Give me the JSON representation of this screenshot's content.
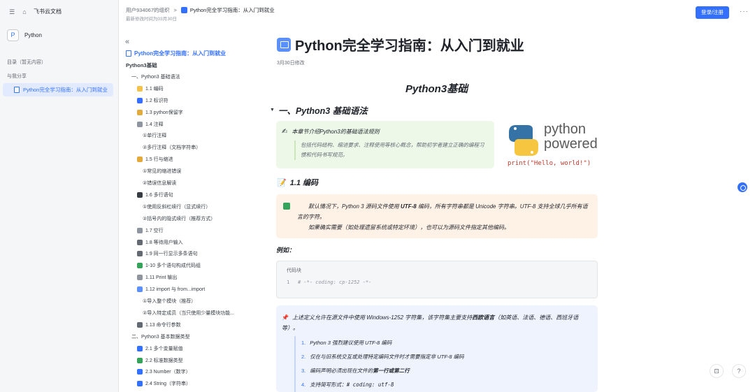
{
  "sidebar": {
    "app_name": "飞书云文档",
    "space_name": "Python",
    "space_logo": "P",
    "toc_label": "目录（暂无内容）",
    "shared_label": "与我分享",
    "shared_doc": "Python完全学习指南：从入门到就业"
  },
  "header": {
    "breadcrumb_org": "用户934067的组织",
    "breadcrumb_sep": ">",
    "breadcrumb_doc": "Python完全学习指南：从入门到就业",
    "last_modified": "最新修改时间为03月30日",
    "login_label": "登录/注册",
    "more_label": "···"
  },
  "outline": {
    "collapse_label": "«",
    "top": "Python完全学习指南：从入门到就业",
    "items": [
      {
        "label": "Python3基础",
        "level": 0,
        "icon": ""
      },
      {
        "label": "一、Python3 基础语法",
        "level": 1,
        "icon": ""
      },
      {
        "label": "1.1 编码",
        "level": 2,
        "icon": "#f5c04b"
      },
      {
        "label": "1.2 标识符",
        "level": 2,
        "icon": "#3370ff"
      },
      {
        "label": "1.3 python保留字",
        "level": 2,
        "icon": "#e2a93b"
      },
      {
        "label": "1.4 注释",
        "level": 2,
        "icon": "#8f959e"
      },
      {
        "label": "①单行注释",
        "level": 3,
        "icon": ""
      },
      {
        "label": "②多行注释（文档字符串）",
        "level": 3,
        "icon": ""
      },
      {
        "label": "1.5 行与缩进",
        "level": 2,
        "icon": "#e2a93b"
      },
      {
        "label": "①常见的缩进错误",
        "level": 3,
        "icon": ""
      },
      {
        "label": "②错误信息解读",
        "level": 3,
        "icon": ""
      },
      {
        "label": "1.6 多行语句",
        "level": 2,
        "icon": "#373c43"
      },
      {
        "label": "①使用反斜杠续行（显式续行）",
        "level": 3,
        "icon": ""
      },
      {
        "label": "②括号内的隐式续行（推荐方式）",
        "level": 3,
        "icon": ""
      },
      {
        "label": "1.7 空行",
        "level": 2,
        "icon": "#8f959e"
      },
      {
        "label": "1.8 等待用户输入",
        "level": 2,
        "icon": "#646a73"
      },
      {
        "label": "1.9 同一行显示多条语句",
        "level": 2,
        "icon": "#646a73"
      },
      {
        "label": "1-10 多个语句构成代码组",
        "level": 2,
        "icon": "#36a35a"
      },
      {
        "label": "1.11 Print 输出",
        "level": 2,
        "icon": "#8f959e"
      },
      {
        "label": "1.12 import 与 from...import",
        "level": 2,
        "icon": "#5b8ff9"
      },
      {
        "label": "①导入整个模块（推荐）",
        "level": 3,
        "icon": ""
      },
      {
        "label": "②导入特定成员（当只使用少量模块功能...",
        "level": 3,
        "icon": ""
      },
      {
        "label": "1.13 命令行参数",
        "level": 2,
        "icon": "#646a73"
      },
      {
        "label": "二、Python3 基本数据类型",
        "level": 1,
        "icon": ""
      },
      {
        "label": "2.1 多个变量赋值",
        "level": 2,
        "icon": "#3370ff"
      },
      {
        "label": "2.2 标准数据类型",
        "level": 2,
        "icon": "#36a35a"
      },
      {
        "label": "2.3 Number（数字）",
        "level": 2,
        "icon": "#3370ff"
      },
      {
        "label": "2.4 String（字符串）",
        "level": 2,
        "icon": "#3370ff"
      }
    ]
  },
  "content": {
    "title": "Python完全学习指南：从入门到就业",
    "modified": "3月30日修改",
    "h1": "Python3基础",
    "h2": "一、Python3 基础语法",
    "intro_head": "本章节介绍Python3的基础语法规则",
    "intro_body": "包括代码结构、缩进要求、注释使用等核心概念，帮助初学者建立正确的编程习惯和代码书写规范。",
    "python_logo_line1": "python",
    "python_logo_line2": "powered",
    "python_code": "print(\"Hello, world!\")",
    "h3": "1.1 编码",
    "encoding_p1_a": "默认情况下，Python 3 源码文件使用 ",
    "encoding_p1_b": "UTF-8",
    "encoding_p1_c": " 编码，所有字符串都是 Unicode 字符串。UTF-8 支持全球几乎所有语言的字符。",
    "encoding_p2": "如果确实需要（如处理遗留系统或特定环境），也可以为源码文件指定其他编码。",
    "example_label": "例如：",
    "code_label": "代码块",
    "code_line_no": "1",
    "code_line": "# -*- coding: cp-1252 -*-",
    "note_a": "上述定义允许在源文件中使用 Windows-1252 字符集，该字符集主要支持",
    "note_b": "西欧语言",
    "note_c": "（如英语、法语、德语、西班牙语等）。",
    "list": [
      {
        "num": "1.",
        "text": "Python 3 强烈建议使用 UTF-8 编码"
      },
      {
        "num": "2.",
        "text": "仅在与旧系统交互或处理特定编码文件时才需要指定非 UTF-8 编码"
      },
      {
        "num": "3.",
        "text": "编码声明必须出现在文件的",
        "bold": "第一行或第二行"
      },
      {
        "num": "4.",
        "text": "支持简写形式：",
        "mono": "# coding: utf-8"
      }
    ]
  },
  "colors": {
    "accent": "#3370ff",
    "green_callout": "#eef8e9",
    "orange_callout": "#fef1e6",
    "blue_callout": "#eef3fe"
  }
}
